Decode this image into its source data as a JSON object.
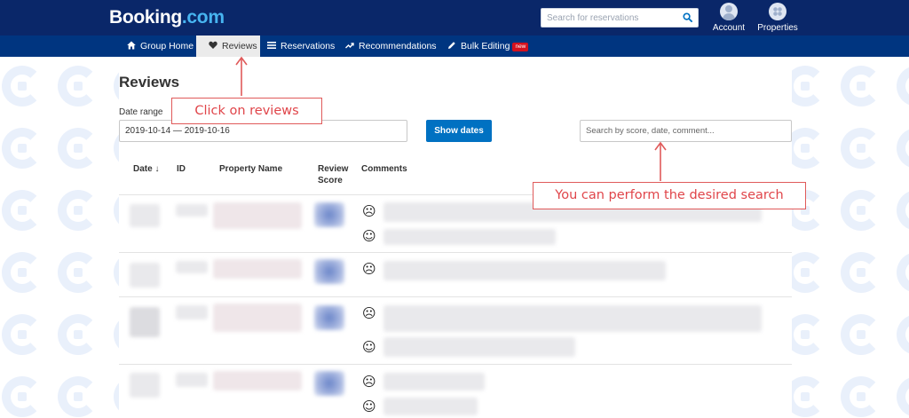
{
  "header": {
    "logo_main": "Booking",
    "logo_suffix": ".com",
    "search_placeholder": "Search for reservations",
    "account_label": "Account",
    "properties_label": "Properties"
  },
  "nav": {
    "items": [
      {
        "label": "Group Home",
        "icon": "home-icon"
      },
      {
        "label": "Reviews",
        "icon": "heart-icon",
        "active": true
      },
      {
        "label": "Reservations",
        "icon": "list-icon"
      },
      {
        "label": "Recommendations",
        "icon": "trend-icon"
      },
      {
        "label": "Bulk Editing",
        "icon": "pencil-icon",
        "badge": "new"
      }
    ]
  },
  "main": {
    "title": "Reviews",
    "date_range_label": "Date range",
    "date_range_value": "2019-10-14 — 2019-10-16",
    "show_dates_label": "Show dates",
    "search_placeholder": "Search by score, date, comment...",
    "columns": {
      "date": "Date ↓",
      "id": "ID",
      "property_name": "Property Name",
      "review_score": "Review Score",
      "comments": "Comments"
    },
    "sad_face": "☹",
    "happy_face": "☺"
  },
  "annotations": {
    "reviews_callout": "Click on reviews",
    "search_callout": "You can perform the desired search",
    "color": "#e0454a"
  },
  "colors": {
    "topbar": "#0a2769",
    "navbar": "#003580",
    "primary_button": "#0071c2",
    "badge": "#d4111e"
  }
}
